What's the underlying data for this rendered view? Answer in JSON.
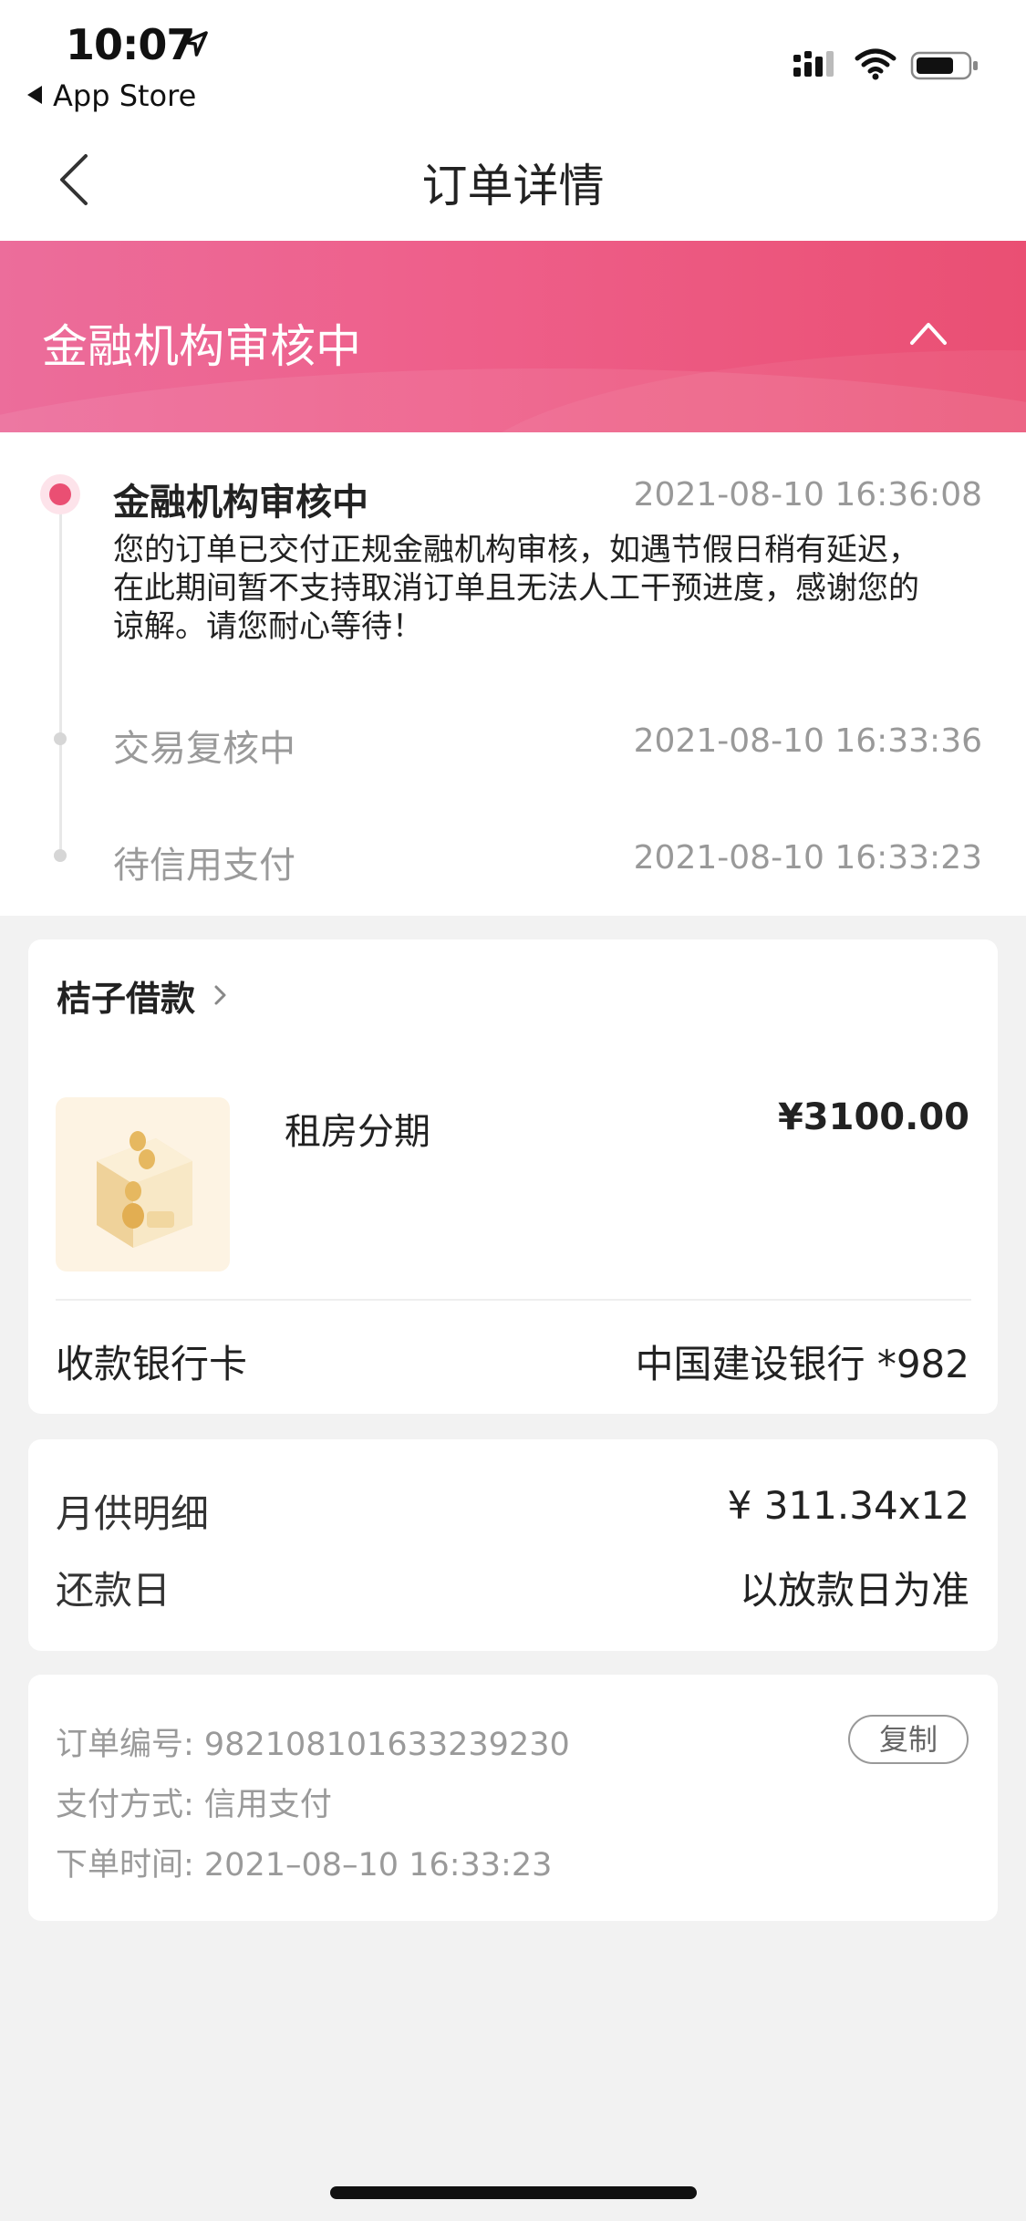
{
  "status_bar": {
    "time": "10:07",
    "back_app": "App Store",
    "icons": [
      "location-arrow-icon",
      "cellular-signal-icon",
      "wifi-icon",
      "battery-icon"
    ]
  },
  "nav": {
    "title": "订单详情",
    "back_icon": "chevron-left-icon"
  },
  "banner": {
    "status": "金融机构审核中",
    "toggle_icon": "chevron-up-icon",
    "colors": {
      "start": "#ec6d9b",
      "end": "#ea4f73"
    }
  },
  "timeline": [
    {
      "title": "金融机构审核中",
      "time": "2021-08-10 16:36:08",
      "desc_lines": [
        "您的订单已交付正规金融机构审核，如遇节假日稍有延迟，",
        "在此期间暂不支持取消订单且无法人工干预进度，感谢您的",
        "谅解。请您耐心等待！"
      ],
      "active": true
    },
    {
      "title": "交易复核中",
      "time": "2021-08-10 16:33:36",
      "active": false
    },
    {
      "title": "待信用支付",
      "time": "2021-08-10 16:33:23",
      "active": false
    }
  ],
  "order_card": {
    "merchant": "桔子借款",
    "product_name": "租房分期",
    "price": "¥3100.00",
    "bank_label": "收款银行卡",
    "bank_value": "中国建设银行 *982"
  },
  "repayment_card": {
    "monthly_label": "月供明细",
    "monthly_value": "¥ 311.34x12",
    "repay_day_label": "还款日",
    "repay_day_value": "以放款日为准"
  },
  "info_card": {
    "order_no": "订单编号: 982108101633239230",
    "pay_method": "支付方式: 信用支付",
    "order_time": "下单时间: 2021–08–10 16:33:23",
    "copy_label": "复制"
  },
  "accent_color": "#ea4f73"
}
